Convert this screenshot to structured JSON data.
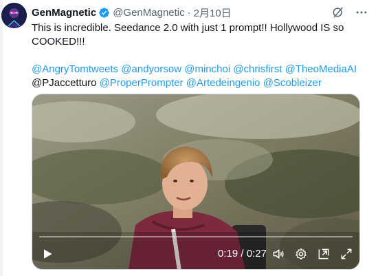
{
  "author": {
    "display_name": "GenMagnetic",
    "handle": "@GenMagnetic",
    "separator": "·",
    "date": "2月10日",
    "verified": true
  },
  "header_actions": {
    "icons": [
      "grok-icon",
      "more-icon"
    ]
  },
  "tweet": {
    "line1": "This is incredible. Seedance 2.0 with just 1 prompt!! Hollywood IS so",
    "line2": "COOKED!!!",
    "mentions": [
      {
        "text": "@AngryTomtweets",
        "linked": true
      },
      {
        "text": "@andyorsow",
        "linked": true
      },
      {
        "text": "@minchoi",
        "linked": true
      },
      {
        "text": "@chrisfirst",
        "linked": true
      },
      {
        "text": "@TheoMediaAI",
        "linked": true
      },
      {
        "text": "@PJaccetturo",
        "linked": false
      },
      {
        "text": "@ProperPrompter",
        "linked": true
      },
      {
        "text": "@Artedeingenio",
        "linked": true
      },
      {
        "text": "@Scobleizer",
        "linked": true
      }
    ]
  },
  "video": {
    "current_time": "0:19",
    "time_separator": "/",
    "duration": "0:27",
    "progress": 0.0,
    "controls": [
      "play-icon",
      "volume-icon",
      "settings-icon",
      "pip-icon",
      "fullscreen-icon"
    ]
  },
  "colors": {
    "link": "#1d9bf0",
    "text": "#0f1419",
    "secondary": "#536471",
    "verified": "#1d9bf0"
  }
}
